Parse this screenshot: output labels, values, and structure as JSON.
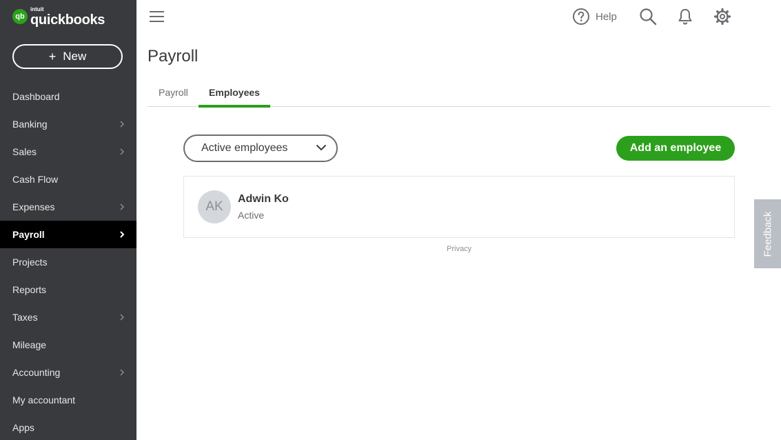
{
  "app": {
    "brand": "intuit",
    "name": "quickbooks",
    "badge": "qb"
  },
  "sidebar": {
    "new_label": "New",
    "items": [
      {
        "label": "Dashboard",
        "chevron": false
      },
      {
        "label": "Banking",
        "chevron": true
      },
      {
        "label": "Sales",
        "chevron": true
      },
      {
        "label": "Cash Flow",
        "chevron": false
      },
      {
        "label": "Expenses",
        "chevron": true
      },
      {
        "label": "Payroll",
        "chevron": true,
        "active": true
      },
      {
        "label": "Projects",
        "chevron": false
      },
      {
        "label": "Reports",
        "chevron": false
      },
      {
        "label": "Taxes",
        "chevron": true
      },
      {
        "label": "Mileage",
        "chevron": false
      },
      {
        "label": "Accounting",
        "chevron": true
      },
      {
        "label": "My accountant",
        "chevron": false
      },
      {
        "label": "Apps",
        "chevron": false
      }
    ]
  },
  "topbar": {
    "help_label": "Help"
  },
  "page": {
    "title": "Payroll",
    "tabs": [
      {
        "label": "Payroll",
        "active": false
      },
      {
        "label": "Employees",
        "active": true
      }
    ],
    "filter_label": "Active employees",
    "add_button_label": "Add an employee",
    "employees": [
      {
        "initials": "AK",
        "name": "Adwin Ko",
        "status": "Active"
      }
    ],
    "privacy_label": "Privacy"
  },
  "feedback_label": "Feedback",
  "colors": {
    "sidebar": "#393a3d",
    "accent": "#2ca01c",
    "active_nav": "#000000"
  }
}
